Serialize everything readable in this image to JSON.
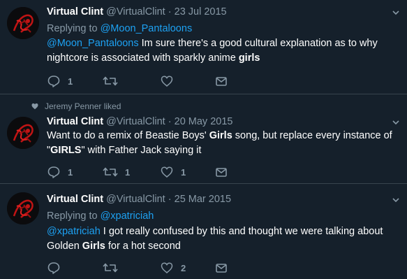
{
  "tweets": [
    {
      "name": "Virtual Clint",
      "handle": "@VirtualClint",
      "dot": "·",
      "date": "23 Jul 2015",
      "reply_prefix": "Replying to",
      "reply_to": "@Moon_Pantaloons",
      "text_parts": {
        "mention": "@Moon_Pantaloons",
        "a": " Im sure there's a good cultural explanation as to why nightcore is associated with sparkly anime ",
        "b": "girls"
      },
      "reply_count": "1",
      "retweet_count": "",
      "like_count": ""
    },
    {
      "social_context": "Jeremy Penner liked",
      "name": "Virtual Clint",
      "handle": "@VirtualClint",
      "dot": "·",
      "date": "20 May 2015",
      "text_parts": {
        "a": "Want to do a remix of Beastie Boys' ",
        "b": "Girls",
        "c": " song, but replace every instance of \"",
        "d": "GIRLS",
        "e": "\" with Father Jack saying it"
      },
      "reply_count": "1",
      "retweet_count": "1",
      "like_count": "1"
    },
    {
      "name": "Virtual Clint",
      "handle": "@VirtualClint",
      "dot": "·",
      "date": "25 Mar 2015",
      "reply_prefix": "Replying to",
      "reply_to": "@xpatriciah",
      "text_parts": {
        "mention": "@xpatriciah",
        "a": " I got really confused by this and thought we were talking about Golden ",
        "b": "Girls",
        "c": " for a hot second"
      },
      "reply_count": "",
      "retweet_count": "",
      "like_count": "2"
    }
  ],
  "icons": {
    "reply": "reply-icon",
    "retweet": "retweet-icon",
    "like": "heart-icon",
    "share": "share-icon",
    "caret": "chevron-down-icon",
    "liked": "heart-icon"
  },
  "colors": {
    "background": "#15202b",
    "link": "#1da1f2",
    "muted": "#8899a6",
    "divider": "#38444d",
    "avatar_accent": "#c01414"
  }
}
